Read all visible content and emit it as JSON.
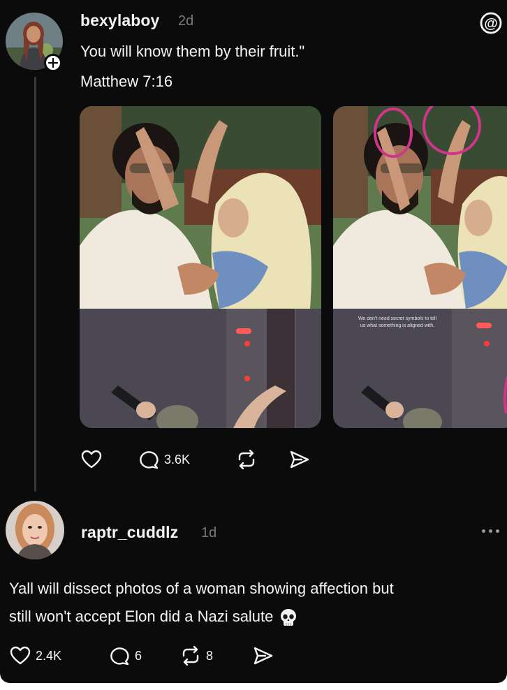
{
  "post": {
    "username": "bexylaboy",
    "time": "2d",
    "text_line1": "You will know them by their fruit.\"",
    "text_line2": "Matthew 7:16",
    "image1_caption_line1": "We don't need secret symbols to tell",
    "image1_caption_line2": "us what something is aligned with.",
    "actions": {
      "like_count": "",
      "reply_count": "3.6K",
      "repost_count": "",
      "share_count": ""
    }
  },
  "reply": {
    "username": "raptr_cuddlz",
    "time": "1d",
    "text_line1": "Yall will dissect photos of a woman showing affection but",
    "text_line2": "still won't accept Elon did a Nazi salute",
    "actions": {
      "like_count": "2.4K",
      "reply_count": "6",
      "repost_count": "8"
    }
  },
  "icons": {
    "app_logo": "threads-logo-icon",
    "like": "heart-icon",
    "reply": "speech-bubble-icon",
    "repost": "repost-icon",
    "share": "send-icon",
    "follow": "plus-icon",
    "more": "more-dots-icon",
    "emoji": "skull-emoji-icon"
  },
  "colors": {
    "background": "#0b0b0c",
    "text": "#f3f5f7",
    "muted": "#7a7a7a",
    "annotation": "#d0358a"
  }
}
